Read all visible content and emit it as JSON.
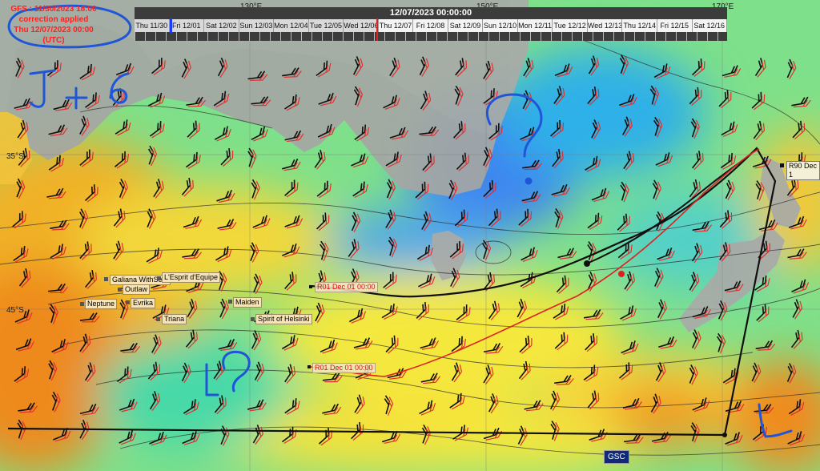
{
  "info": {
    "gfs_line": "GFS : 11/30/2023 18:00",
    "correction_line": "correction applied",
    "time_line": "Thu 12/07/2023 00:00",
    "utc_line": "(UTC)"
  },
  "timeline": {
    "current_datetime": "12/07/2023 00:00:00",
    "days": [
      "Thu 11/30",
      "Fri 12/01",
      "Sat 12/02",
      "Sun 12/03",
      "Mon 12/04",
      "Tue 12/05",
      "Wed 12/06",
      "Thu 12/07",
      "Fri 12/08",
      "Sat 12/09",
      "Sun 12/10",
      "Mon 12/11",
      "Tue 12/12",
      "Wed 12/13",
      "Thu 12/14",
      "Fri 12/15",
      "Sat 12/16"
    ],
    "selected_index": 7
  },
  "axes": {
    "longitudes": [
      "130°E",
      "150°E",
      "170°E"
    ],
    "latitudes": [
      "35°S",
      "45°S"
    ]
  },
  "boats": [
    "Galiana WithSe...",
    "L'Esprit d'Equipe",
    "Outlaw",
    "Evrika",
    "Neptune",
    "Maiden",
    "Triana",
    "Spirit of Helsinki"
  ],
  "route_labels": {
    "upper": "R01 Dec 01 00:00",
    "lower": "R01 Dec 01 00:00",
    "destination": "R90 Dec 1"
  },
  "badge": "GSC",
  "colors": {
    "land": "#a9aaa7",
    "calm_wind": "#3f7df0",
    "moderate_wind": "#3fd6a0",
    "strong_wind": "#f5e23a",
    "gale_wind": "#f08a1e",
    "route_red": "#e02020",
    "route_black": "#101010",
    "annotation_blue": "#1f56d8"
  },
  "annotations": [
    "J+6",
    "?",
    "?",
    "L"
  ]
}
